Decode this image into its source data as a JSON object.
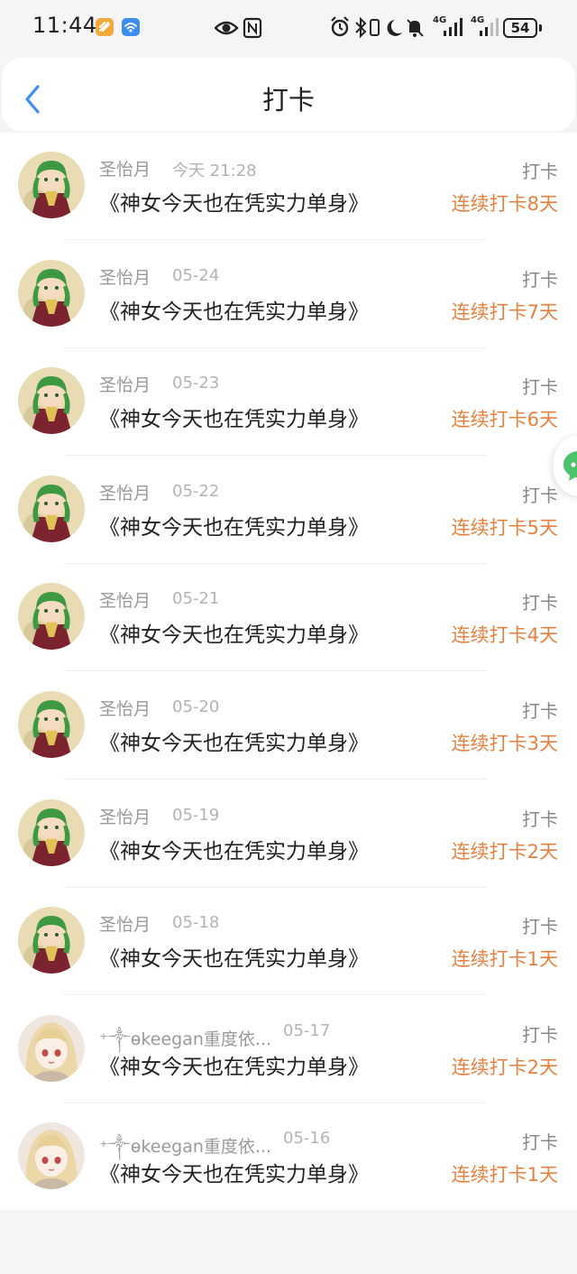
{
  "status_bar": {
    "time": "11:44",
    "signal_1": "4G",
    "signal_2": "4G",
    "battery": "54",
    "icons": [
      "bell-icon-app",
      "wifi-app-icon",
      "eye-icon",
      "nfc-icon",
      "alarm-icon",
      "bluetooth-icon",
      "vibrate-icon",
      "moon-icon",
      "mute-icon",
      "signal-icon",
      "battery-icon"
    ]
  },
  "header": {
    "title": "打卡",
    "back_icon": "chevron-left-icon"
  },
  "colors": {
    "accent": "#e8813f",
    "back": "#3d8ef0",
    "chat": "#4cc26d"
  },
  "checkins": [
    {
      "user": "圣怡月",
      "date": "今天 21:28",
      "book": "《神女今天也在凭实力单身》",
      "label": "打卡",
      "streak": "连续打卡8天",
      "avatar": "green-hair-avatar"
    },
    {
      "user": "圣怡月",
      "date": "05-24",
      "book": "《神女今天也在凭实力单身》",
      "label": "打卡",
      "streak": "连续打卡7天",
      "avatar": "green-hair-avatar"
    },
    {
      "user": "圣怡月",
      "date": "05-23",
      "book": "《神女今天也在凭实力单身》",
      "label": "打卡",
      "streak": "连续打卡6天",
      "avatar": "green-hair-avatar"
    },
    {
      "user": "圣怡月",
      "date": "05-22",
      "book": "《神女今天也在凭实力单身》",
      "label": "打卡",
      "streak": "连续打卡5天",
      "avatar": "green-hair-avatar"
    },
    {
      "user": "圣怡月",
      "date": "05-21",
      "book": "《神女今天也在凭实力单身》",
      "label": "打卡",
      "streak": "连续打卡4天",
      "avatar": "green-hair-avatar"
    },
    {
      "user": "圣怡月",
      "date": "05-20",
      "book": "《神女今天也在凭实力单身》",
      "label": "打卡",
      "streak": "连续打卡3天",
      "avatar": "green-hair-avatar"
    },
    {
      "user": "圣怡月",
      "date": "05-19",
      "book": "《神女今天也在凭实力单身》",
      "label": "打卡",
      "streak": "连续打卡2天",
      "avatar": "green-hair-avatar"
    },
    {
      "user": "圣怡月",
      "date": "05-18",
      "book": "《神女今天也在凭实力单身》",
      "label": "打卡",
      "streak": "连续打卡1天",
      "avatar": "green-hair-avatar"
    },
    {
      "user": "⁺༒ɵkeegan重度依...",
      "date": "05-17",
      "book": "《神女今天也在凭实力单身》",
      "label": "打卡",
      "streak": "连续打卡2天",
      "avatar": "blonde-hair-avatar"
    },
    {
      "user": "⁺༒ɵkeegan重度依...",
      "date": "05-16",
      "book": "《神女今天也在凭实力单身》",
      "label": "打卡",
      "streak": "连续打卡1天",
      "avatar": "blonde-hair-avatar"
    }
  ]
}
